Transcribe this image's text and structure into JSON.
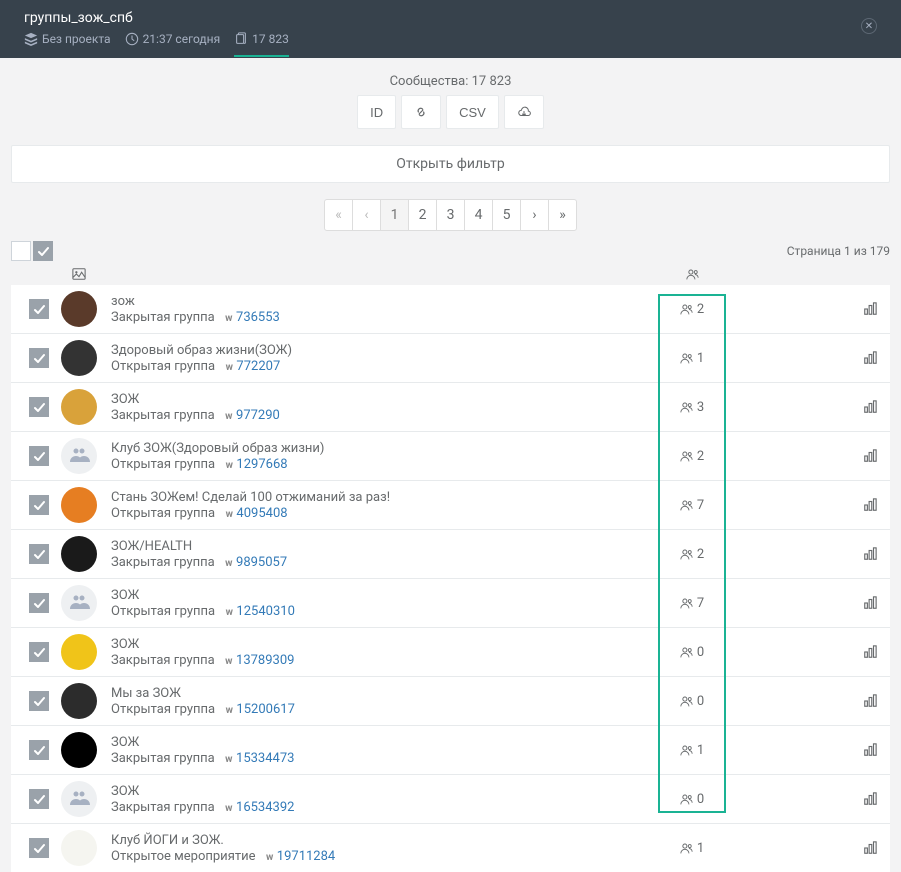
{
  "header": {
    "title": "группы_зож_спб",
    "project": "Без проекта",
    "time": "21:37 сегодня",
    "count": "17 823"
  },
  "toolbar": {
    "communities_label": "Сообщества: 17 823",
    "id": "ID",
    "csv": "CSV"
  },
  "filter_label": "Открыть фильтр",
  "pagination": [
    "«",
    "‹",
    "1",
    "2",
    "3",
    "4",
    "5",
    "›",
    "»"
  ],
  "page_info": "Страница 1 из 179",
  "rows": [
    {
      "title_parts": [
        "з",
        "ож"
      ],
      "type": "Закрытая группа",
      "vk_id": "736553",
      "count": "2",
      "avatar_bg": "#5a3a2a",
      "placeholder": false
    },
    {
      "title_parts": [
        "Здоровый образ жизни(ЗОЖ)"
      ],
      "type": "Открытая группа",
      "vk_id": "772207",
      "count": "1",
      "avatar_bg": "#333333",
      "placeholder": false
    },
    {
      "title_parts": [
        "ЗОЖ"
      ],
      "type": "Закрытая группа",
      "vk_id": "977290",
      "count": "3",
      "avatar_bg": "#d9a23a",
      "placeholder": false
    },
    {
      "title_parts": [
        "Клуб ЗОЖ(Здоровый образ жизни)"
      ],
      "type": "Открытая группа",
      "vk_id": "1297668",
      "count": "2",
      "avatar_bg": "",
      "placeholder": true
    },
    {
      "title_parts": [
        "Стань ЗОЖем! Сделай 100 отжиманий",
        " за ",
        "раз!"
      ],
      "type": "Открытая группа",
      "vk_id": "4095408",
      "count": "7",
      "avatar_bg": "#e67e22",
      "placeholder": false
    },
    {
      "title_parts": [
        "ЗОЖ/HEALTH"
      ],
      "type": "Закрытая группа",
      "vk_id": "9895057",
      "count": "2",
      "avatar_bg": "#1a1a1a",
      "placeholder": false
    },
    {
      "title_parts": [
        "ЗОЖ"
      ],
      "type": "Открытая группа",
      "vk_id": "12540310",
      "count": "7",
      "avatar_bg": "",
      "placeholder": true
    },
    {
      "title_parts": [
        "ЗОЖ"
      ],
      "type": "Закрытая группа",
      "vk_id": "13789309",
      "count": "0",
      "avatar_bg": "#f0c419",
      "placeholder": false
    },
    {
      "title_parts": [
        "Мы за ",
        "ЗОЖ"
      ],
      "type": "Открытая группа",
      "vk_id": "15200617",
      "count": "0",
      "avatar_bg": "#2c2c2c",
      "placeholder": false
    },
    {
      "title_parts": [
        "ЗОЖ"
      ],
      "type": "Закрытая группа",
      "vk_id": "15334473",
      "count": "1",
      "avatar_bg": "#000000",
      "placeholder": false
    },
    {
      "title_parts": [
        "ЗОЖ"
      ],
      "type": "Закрытая группа",
      "vk_id": "16534392",
      "count": "0",
      "avatar_bg": "",
      "placeholder": true
    },
    {
      "title_parts": [
        "Клуб ЙОГИ",
        " и ",
        "ЗОЖ",
        "."
      ],
      "type": "Открытое мероприятие",
      "vk_id": "19711284",
      "count": "1",
      "avatar_bg": "#f5f5f0",
      "placeholder": false
    }
  ]
}
